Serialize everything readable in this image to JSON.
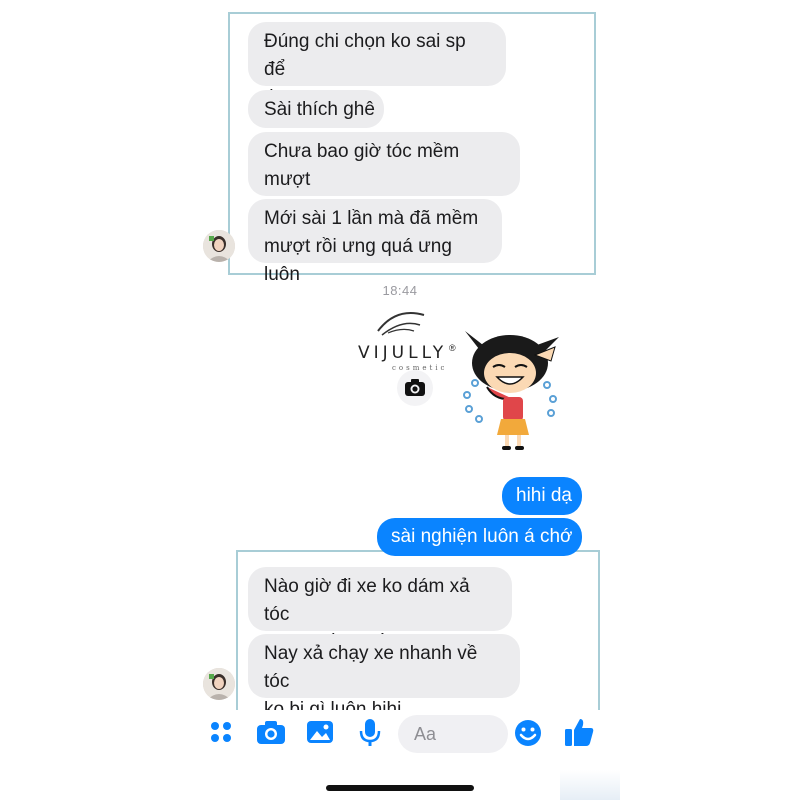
{
  "conversation": {
    "group1": {
      "messages": [
        {
          "text": "Đúng chi chọn ko sai sp để\ntheo"
        },
        {
          "text": "Sài thích ghê"
        },
        {
          "text": "Chưa bao giờ tóc mềm mượt\nnhư giờ"
        },
        {
          "text": "Mới sài 1 lần mà đã mềm\nmượt rồi ưng quá ưng luôn"
        }
      ]
    },
    "timestamp": "18:44",
    "shared_image": {
      "brand": "VIJULLY",
      "registered_mark": "®",
      "tagline": "cosmetic"
    },
    "outgoing": [
      {
        "text": "hihi dạ"
      },
      {
        "text": "sài nghiện luôn á chớ"
      }
    ],
    "group2": {
      "messages": [
        {
          "text": "Nào giờ đi xe ko dám xả tóc\ndài sợ về bị rối"
        },
        {
          "text": "Nay xả chạy xe nhanh về tóc\nko bị gì luôn hihi"
        }
      ]
    }
  },
  "composer": {
    "placeholder": "Aa",
    "icons": [
      "apps-icon",
      "camera-icon",
      "photo-icon",
      "microphone-icon",
      "emoji-icon",
      "thumbs-up-icon"
    ]
  },
  "colors": {
    "accent": "#0a84ff",
    "incoming_bubble": "#ececee",
    "highlight_frame": "#a8cdd6"
  }
}
